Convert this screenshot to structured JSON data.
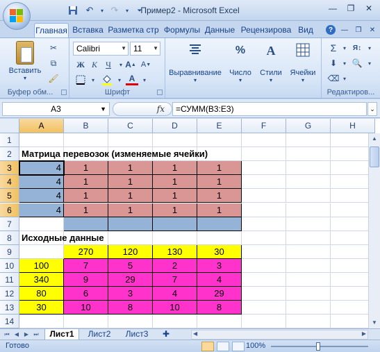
{
  "window": {
    "title": "Пример2 - Microsoft Excel"
  },
  "ribbon": {
    "tabs": [
      "Главная",
      "Вставка",
      "Разметка стр",
      "Формулы",
      "Данные",
      "Рецензирова",
      "Вид"
    ],
    "active_tab": "Главная",
    "paste_label": "Вставить",
    "font_name": "Calibri",
    "font_size": "11",
    "align_label": "Выравнивание",
    "number_label": "Число",
    "styles_label": "Стили",
    "cells_label": "Ячейки",
    "groups": {
      "clipboard": "Буфер обм...",
      "font": "Шрифт",
      "editing": "Редактиров..."
    }
  },
  "formula_bar": {
    "name_box": "A3",
    "fx": "fx",
    "formula": "=СУММ(B3:E3)"
  },
  "grid": {
    "columns": [
      "A",
      "B",
      "C",
      "D",
      "E",
      "F",
      "G",
      "H"
    ],
    "selected_column": "A",
    "rows": [
      "1",
      "2",
      "3",
      "4",
      "5",
      "6",
      "7",
      "8",
      "9",
      "10",
      "11",
      "12",
      "13",
      "14"
    ],
    "title_matrix": "Матрица перевозок (изменяемые ячейки)",
    "title_source": "Исходные данные",
    "matrix_sums": [
      "4",
      "4",
      "4",
      "4"
    ],
    "matrix": [
      [
        "1",
        "1",
        "1",
        "1"
      ],
      [
        "1",
        "1",
        "1",
        "1"
      ],
      [
        "1",
        "1",
        "1",
        "1"
      ],
      [
        "1",
        "1",
        "1",
        "1"
      ]
    ],
    "demand": [
      "270",
      "120",
      "130",
      "30"
    ],
    "supply": [
      "100",
      "340",
      "80",
      "30"
    ],
    "costs": [
      [
        "7",
        "5",
        "2",
        "3"
      ],
      [
        "9",
        "29",
        "7",
        "4"
      ],
      [
        "6",
        "3",
        "4",
        "29"
      ],
      [
        "10",
        "8",
        "10",
        "8"
      ]
    ]
  },
  "colors": {
    "sum_blue": "#95b3d7",
    "matrix_pink": "#da9694",
    "yellow": "#ffff00",
    "magenta": "#ff33cc"
  },
  "sheets": [
    "Лист1",
    "Лист2",
    "Лист3"
  ],
  "active_sheet": "Лист1",
  "status": {
    "text": "Готово",
    "zoom": "100%"
  }
}
